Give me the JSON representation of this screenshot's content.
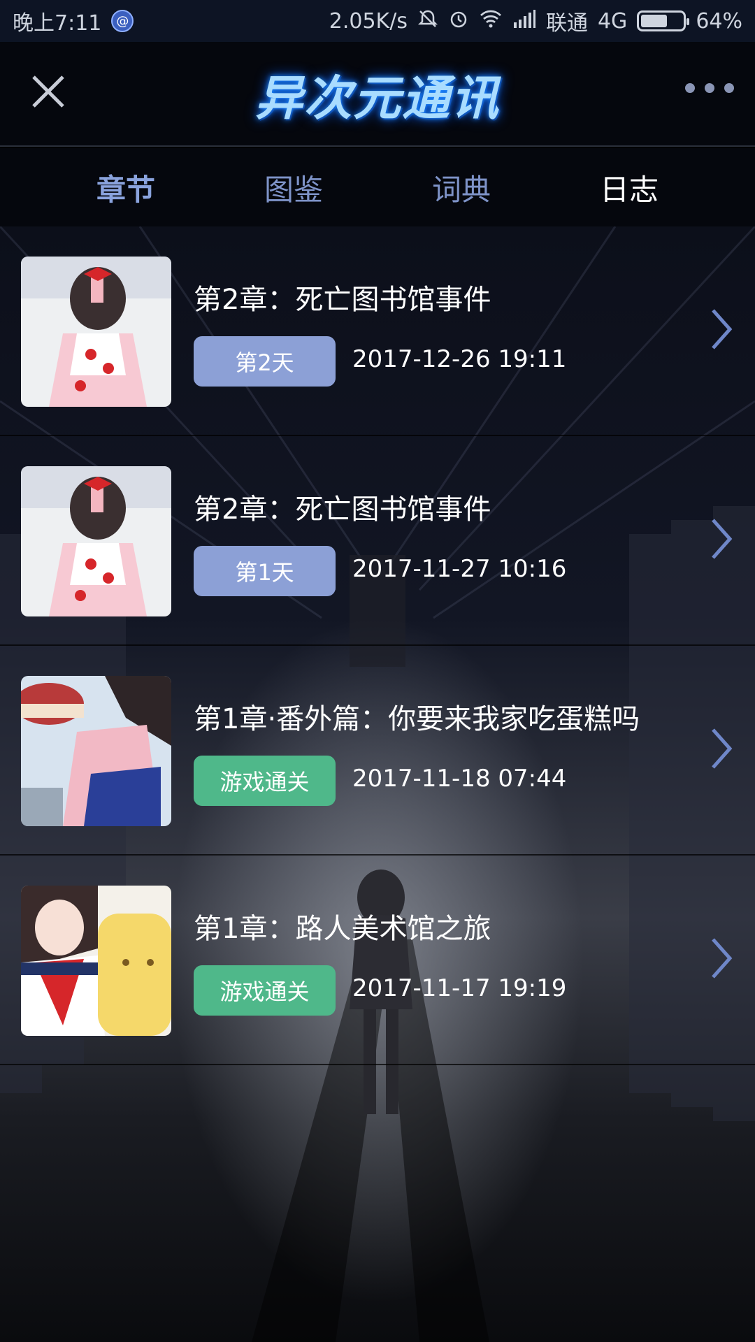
{
  "status_bar": {
    "time": "晚上7:11",
    "badge": "@",
    "speed": "2.05K/s",
    "carrier": "联通",
    "network": "4G",
    "battery": "64%",
    "battery_level": 0.64
  },
  "header": {
    "logo_text": "异次元通讯",
    "close_icon": "close-icon",
    "more_icon": "more-icon"
  },
  "tabs": [
    {
      "label": "章节"
    },
    {
      "label": "图鉴"
    },
    {
      "label": "词典"
    },
    {
      "label": "日志"
    }
  ],
  "chapters": [
    {
      "title": "第2章：死亡图书馆事件",
      "badge": "第2天",
      "badge_type": "day",
      "date": "2017-12-26 19:11"
    },
    {
      "title": "第2章：死亡图书馆事件",
      "badge": "第1天",
      "badge_type": "day",
      "date": "2017-11-27 10:16"
    },
    {
      "title": "第1章·番外篇：你要来我家吃蛋糕吗",
      "badge": "游戏通关",
      "badge_type": "clear",
      "date": "2017-11-18 07:44"
    },
    {
      "title": "第1章：路人美术馆之旅",
      "badge": "游戏通关",
      "badge_type": "clear",
      "date": "2017-11-17 19:19"
    }
  ],
  "colors": {
    "day_badge": "#8ca0d6",
    "clear_badge": "#4fb88a",
    "tab_active": "#8aa3dd"
  }
}
